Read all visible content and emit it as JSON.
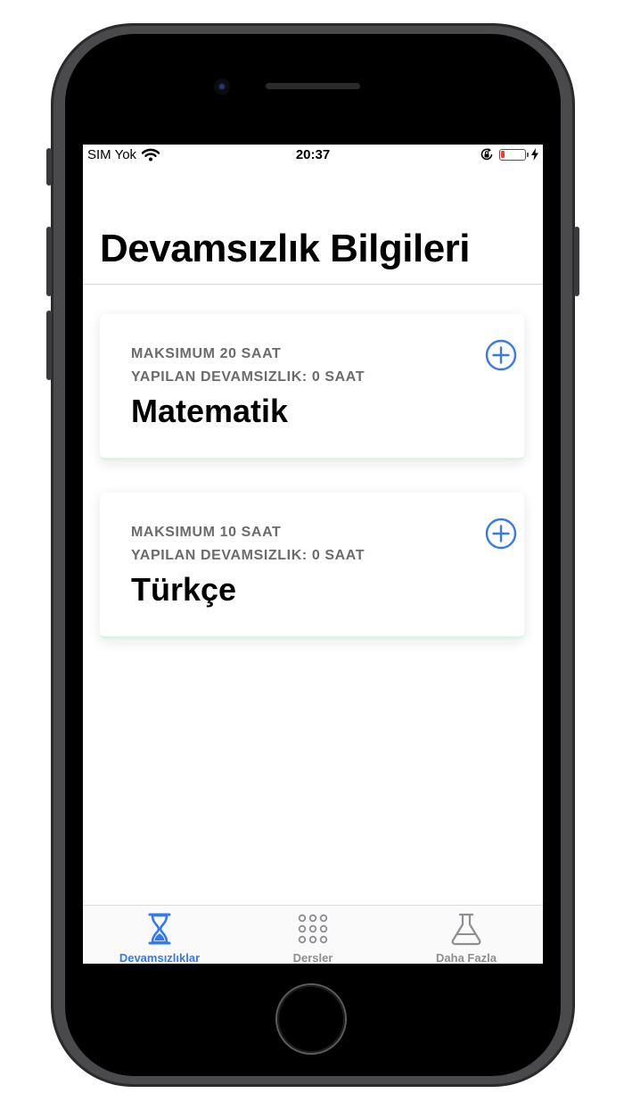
{
  "status_bar": {
    "carrier": "SIM Yok",
    "time": "20:37",
    "battery_level": 0.15
  },
  "page": {
    "title": "Devamsızlık Bilgileri"
  },
  "courses": [
    {
      "max_hours": "MAKSIMUM 20 SAAT",
      "absence": "YAPILAN DEVAMSIZLIK: 0 SAAT",
      "name": "Matematik"
    },
    {
      "max_hours": "MAKSIMUM 10 SAAT",
      "absence": "YAPILAN DEVAMSIZLIK: 0 SAAT",
      "name": "Türkçe"
    }
  ],
  "tab_bar": {
    "tabs": [
      {
        "label": "Devamsızlıklar",
        "icon": "hourglass-icon",
        "active": true
      },
      {
        "label": "Dersler",
        "icon": "grid-dots-icon",
        "active": false
      },
      {
        "label": "Daha Fazla",
        "icon": "flask-icon",
        "active": false
      }
    ]
  },
  "colors": {
    "accent": "#3478f6",
    "inactive": "#8e8e93",
    "card_accent": "#d9f6e3"
  }
}
